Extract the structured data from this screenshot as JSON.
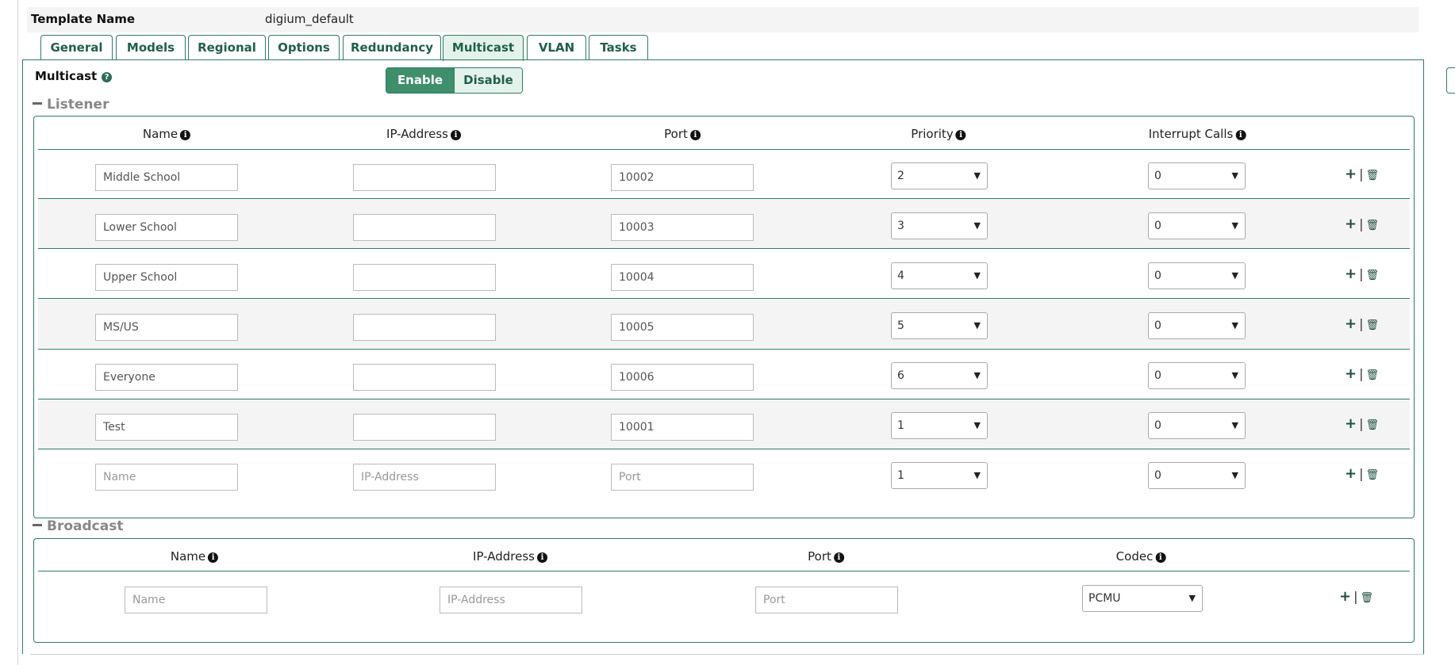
{
  "template": {
    "label": "Template Name",
    "value": "digium_default"
  },
  "tabs": [
    "General",
    "Models",
    "Regional",
    "Options",
    "Redundancy",
    "Multicast",
    "VLAN",
    "Tasks"
  ],
  "active_tab": "Multicast",
  "multicast": {
    "label": "Multicast",
    "enable_label": "Enable",
    "disable_label": "Disable",
    "state": "Enable"
  },
  "listener": {
    "title": "Listener",
    "headers": {
      "name": "Name",
      "ip": "IP-Address",
      "port": "Port",
      "priority": "Priority",
      "interrupt": "Interrupt Calls"
    },
    "rows": [
      {
        "name": "Middle School",
        "ip": "",
        "port": "10002",
        "priority": "2",
        "interrupt": "0"
      },
      {
        "name": "Lower School",
        "ip": "",
        "port": "10003",
        "priority": "3",
        "interrupt": "0"
      },
      {
        "name": "Upper School",
        "ip": "",
        "port": "10004",
        "priority": "4",
        "interrupt": "0"
      },
      {
        "name": "MS/US",
        "ip": "",
        "port": "10005",
        "priority": "5",
        "interrupt": "0"
      },
      {
        "name": "Everyone",
        "ip": "",
        "port": "10006",
        "priority": "6",
        "interrupt": "0"
      },
      {
        "name": "Test",
        "ip": "",
        "port": "10001",
        "priority": "1",
        "interrupt": "0"
      }
    ],
    "new_row": {
      "name_placeholder": "Name",
      "ip_placeholder": "IP-Address",
      "port_placeholder": "Port",
      "priority": "1",
      "interrupt": "0"
    }
  },
  "broadcast": {
    "title": "Broadcast",
    "headers": {
      "name": "Name",
      "ip": "IP-Address",
      "port": "Port",
      "codec": "Codec"
    },
    "new_row": {
      "name_placeholder": "Name",
      "ip_placeholder": "IP-Address",
      "port_placeholder": "Port",
      "codec": "PCMU"
    }
  },
  "icons": {
    "help": "question-icon",
    "info": "info-icon",
    "add": "plus-icon",
    "delete": "trash-icon",
    "section": "collapse-minus-icon"
  },
  "colors": {
    "accent": "#2e7d62",
    "enable_bg": "#3f8e6c",
    "tab_active_bg": "#e4f2ec",
    "row_alt": "#f4f4f4"
  }
}
